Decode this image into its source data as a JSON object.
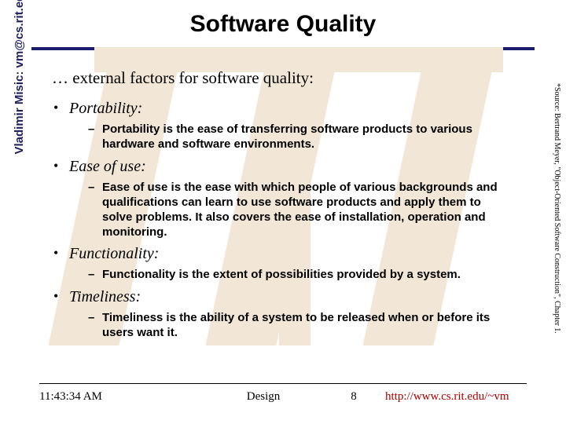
{
  "title": "Software Quality",
  "lead": "… external factors for software quality:",
  "bullets": {
    "b0": {
      "term": "Portability",
      "sub": "Portability is the ease of transferring software products to various hardware and software environments."
    },
    "b1": {
      "term": "Ease of use",
      "sub": "Ease of use is the ease with which people of various backgrounds and qualifications can learn to use software products and apply them to solve problems. It also covers the ease of installation, operation and monitoring."
    },
    "b2": {
      "term": "Functionality",
      "sub": "Functionality is the extent of possibilities provided by a system."
    },
    "b3": {
      "term": "Timeliness",
      "sub": "Timeliness is the ability of a system to be released when or before its users want it."
    }
  },
  "left_label": "Vladimir Misic: vm@cs.rit.edu",
  "right_label": "*Source: Bertrand Meyer, \"Object-Oriented Software Construction\", Chapter 1.",
  "footer": {
    "time": "11:43:34 AM",
    "section": "Design",
    "page": "8",
    "url": "http://www.cs.rit.edu/~vm"
  },
  "colors": {
    "rule": "#1c1c6e",
    "url": "#b00000"
  }
}
